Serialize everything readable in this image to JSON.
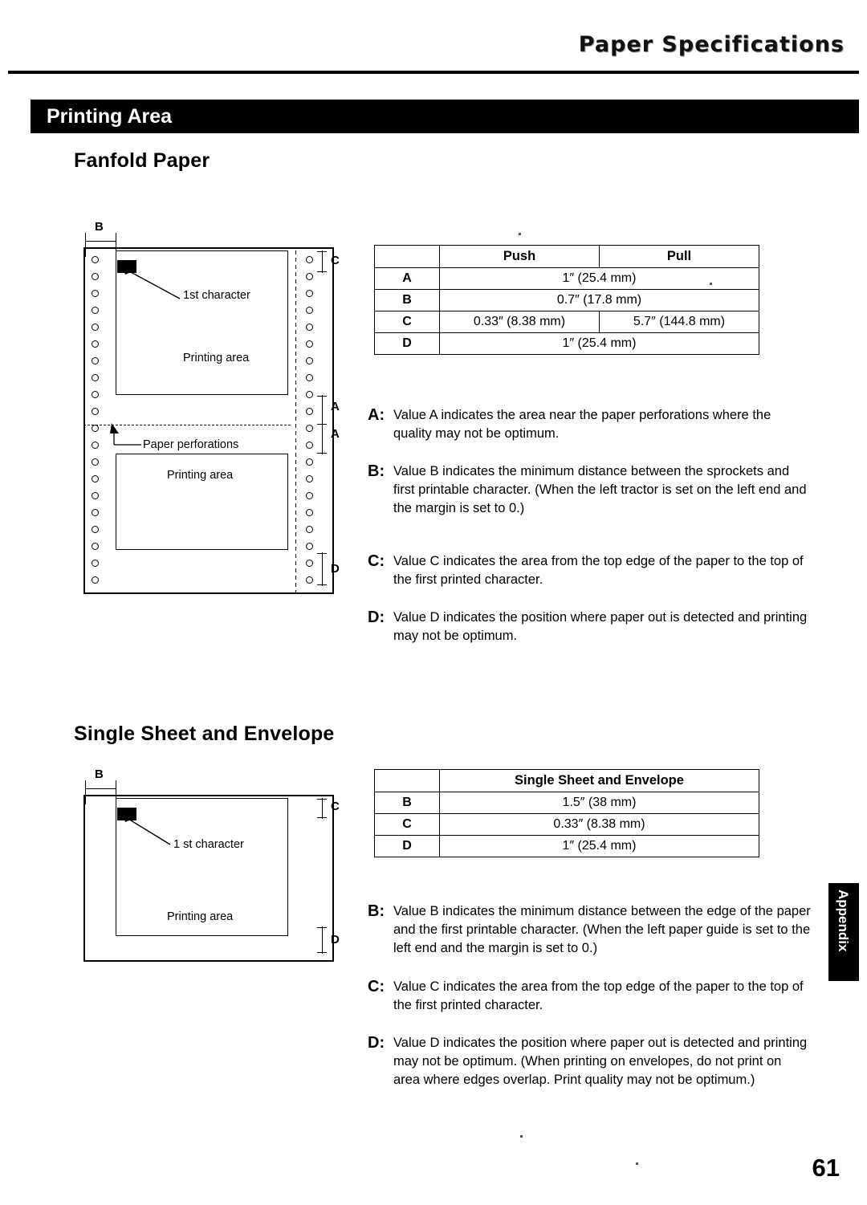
{
  "header": {
    "title": "Paper Specifications"
  },
  "section": {
    "bar_label": "Printing Area"
  },
  "headings": {
    "fanfold": "Fanfold Paper",
    "single": "Single Sheet and Envelope"
  },
  "figure_fanfold": {
    "dim_b": "B",
    "dim_c": "C",
    "dim_a_top": "A",
    "dim_a_bottom": "A",
    "dim_d": "D",
    "label_first_char": "1st character",
    "label_printing_area_top": "Printing area",
    "label_perforations": "Paper perforations",
    "label_printing_area_bottom": "Printing area"
  },
  "figure_single": {
    "dim_b": "B",
    "dim_c": "C",
    "dim_d": "D",
    "label_first_char": "1 st character",
    "label_printing_area": "Printing area"
  },
  "table_fanfold": {
    "columns": [
      "",
      "Push",
      "Pull"
    ],
    "rows": [
      {
        "label": "A",
        "push": "1″ (25.4 mm)",
        "pull": "",
        "merged": true
      },
      {
        "label": "B",
        "push": "0.7″ (17.8 mm)",
        "pull": "",
        "merged": true
      },
      {
        "label": "C",
        "push": "0.33″ (8.38 mm)",
        "pull": "5.7″ (144.8 mm)",
        "merged": false
      },
      {
        "label": "D",
        "push": "1″ (25.4 mm)",
        "pull": "",
        "merged": true
      }
    ]
  },
  "table_single": {
    "columns": [
      "",
      "Single Sheet and Envelope"
    ],
    "rows": [
      {
        "label": "B",
        "value": "1.5″ (38 mm)"
      },
      {
        "label": "C",
        "value": "0.33″ (8.38 mm)"
      },
      {
        "label": "D",
        "value": "1″ (25.4 mm)"
      }
    ]
  },
  "notes_fanfold": [
    {
      "tag": "A:",
      "text": "Value A indicates the area near the paper perforations where the quality may not be optimum."
    },
    {
      "tag": "B:",
      "text": "Value B indicates the minimum distance between the sprockets and first printable character. (When the left tractor is set on the left end and the margin is set to 0.)"
    },
    {
      "tag": "C:",
      "text": "Value C indicates the area from the top edge of the paper to the top of the first printed character."
    },
    {
      "tag": "D:",
      "text": "Value D indicates the position where paper out is detected and printing may not be optimum."
    }
  ],
  "notes_single": [
    {
      "tag": "B:",
      "text": "Value B indicates the minimum distance between the edge of the paper and the first printable character. (When the left paper guide is set to the left end and the margin is set to 0.)"
    },
    {
      "tag": "C:",
      "text": "Value C indicates the area from the top edge of the paper to the top of the first printed character."
    },
    {
      "tag": "D:",
      "text": "Value D indicates the position where paper out is detected and printing may not be optimum. (When printing on envelopes, do not print on area where edges overlap. Print quality may not be optimum.)"
    }
  ],
  "sidebar": {
    "tab_label": "Appendix"
  },
  "footer": {
    "page_number": "61"
  }
}
